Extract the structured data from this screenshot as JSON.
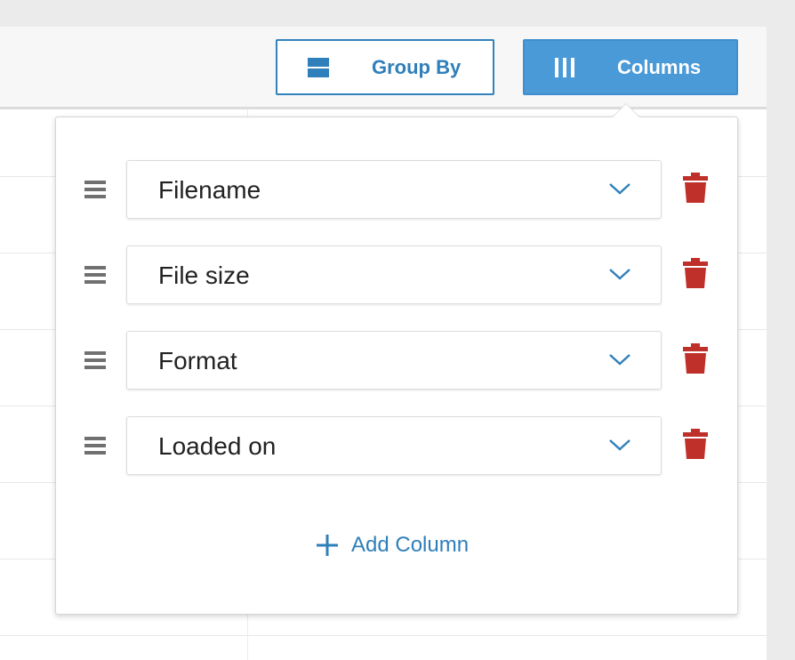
{
  "toolbar": {
    "group_by_label": "Group By",
    "columns_label": "Columns"
  },
  "columns_panel": {
    "rows": [
      {
        "value": "Filename"
      },
      {
        "value": "File size"
      },
      {
        "value": "Format"
      },
      {
        "value": "Loaded on"
      }
    ],
    "add_label": "Add Column"
  },
  "colors": {
    "accent": "#2f7fba",
    "columns_button_bg": "#4a9ad8",
    "delete": "#c0302b",
    "handle": "#707070"
  },
  "icons": {
    "group_by": "group-by-icon",
    "columns": "columns-icon",
    "drag": "drag-handle-icon",
    "dropdown": "chevron-down-icon",
    "delete": "trash-icon",
    "add": "plus-icon"
  }
}
